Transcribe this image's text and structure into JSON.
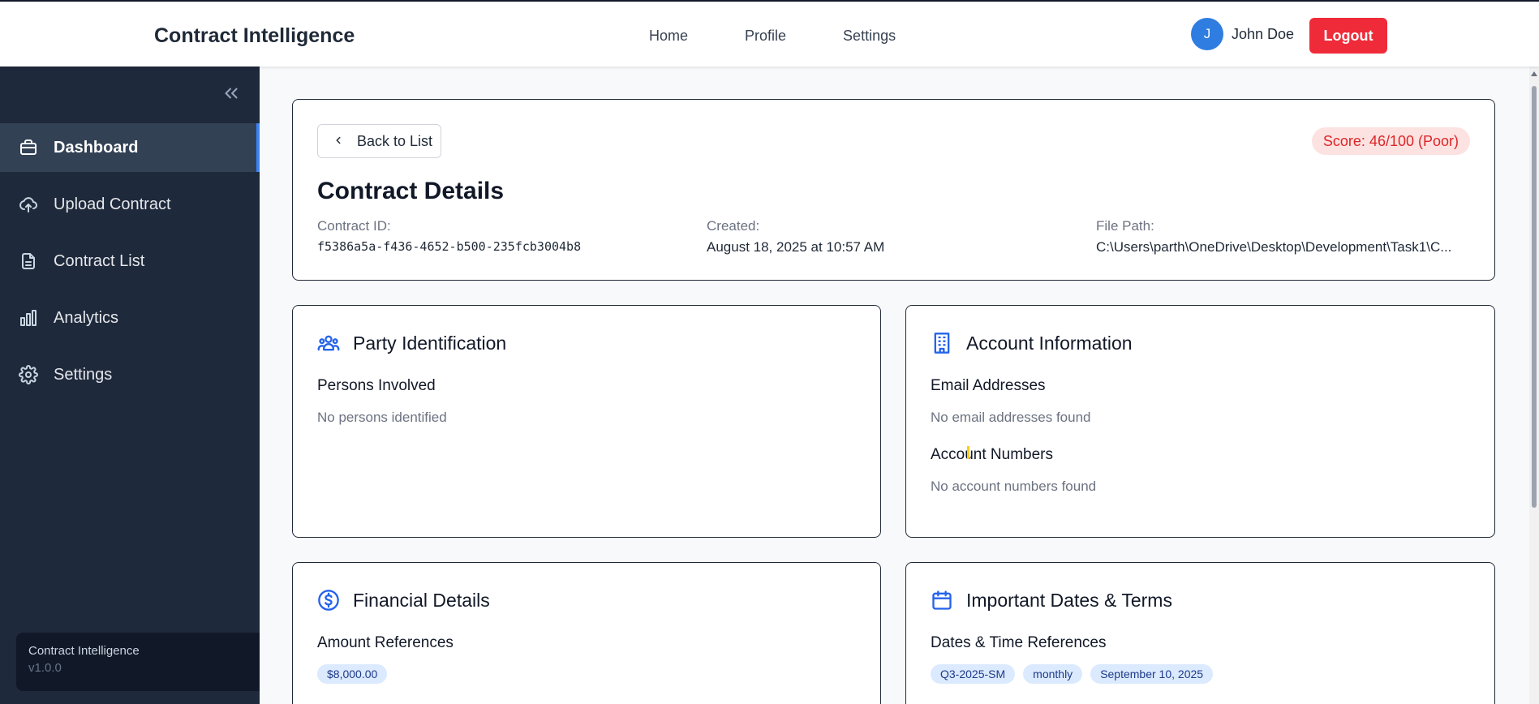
{
  "header": {
    "brand": "Contract Intelligence",
    "nav": [
      "Home",
      "Profile",
      "Settings"
    ],
    "user": {
      "initial": "J",
      "name": "John Doe"
    },
    "logout_label": "Logout"
  },
  "sidebar": {
    "collapse_icon": "double-chevron-left-icon",
    "items": [
      {
        "label": "Dashboard",
        "icon": "briefcase-icon",
        "active": true
      },
      {
        "label": "Upload Contract",
        "icon": "cloud-upload-icon",
        "active": false
      },
      {
        "label": "Contract List",
        "icon": "document-icon",
        "active": false
      },
      {
        "label": "Analytics",
        "icon": "bar-chart-icon",
        "active": false
      },
      {
        "label": "Settings",
        "icon": "gear-icon",
        "active": false
      }
    ],
    "footer": {
      "name": "Contract Intelligence",
      "version": "v1.0.0"
    }
  },
  "details": {
    "back_label": "Back to List",
    "score": "Score: 46/100 (Poor)",
    "title": "Contract Details",
    "contract_id_label": "Contract ID:",
    "contract_id": "f5386a5a-f436-4652-b500-235fcb3004b8",
    "created_label": "Created:",
    "created": "August 18, 2025 at 10:57 AM",
    "file_path_label": "File Path:",
    "file_path": "C:\\Users\\parth\\OneDrive\\Desktop\\Development\\Task1\\C..."
  },
  "party": {
    "title": "Party Identification",
    "persons_label": "Persons Involved",
    "persons_empty": "No persons identified"
  },
  "account": {
    "title": "Account Information",
    "emails_label": "Email Addresses",
    "emails_empty": "No email addresses found",
    "accounts_label": "Account Numbers",
    "accounts_empty": "No account numbers found"
  },
  "financial": {
    "title": "Financial Details",
    "amounts_label": "Amount References",
    "amounts": [
      "$8,000.00"
    ]
  },
  "dates": {
    "title": "Important Dates & Terms",
    "refs_label": "Dates & Time References",
    "refs": [
      "Q3-2025-SM",
      "monthly",
      "September 10, 2025"
    ]
  },
  "colors": {
    "sidebar_bg": "#1e293b",
    "accent": "#3b82f6",
    "logout": "#ef2b3a",
    "score_bg": "#fde2e2",
    "score_text": "#dc2626"
  }
}
